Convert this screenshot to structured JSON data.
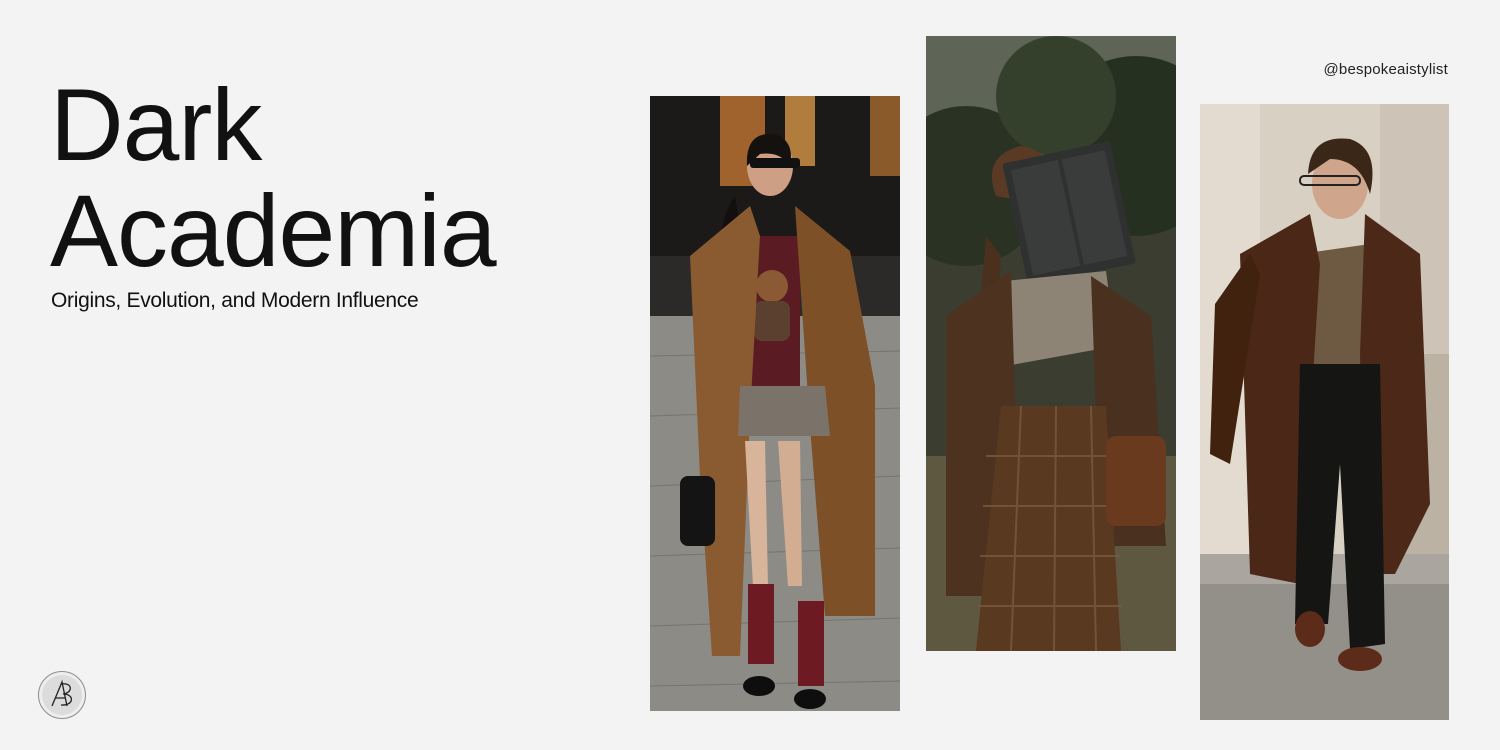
{
  "header": {
    "title_line1": "Dark",
    "title_line2": "Academia",
    "subtitle": "Origins, Evolution, and Modern Influence",
    "handle": "@bespokeaistylist"
  },
  "logo": {
    "icon": "ab-monogram-icon"
  },
  "photos": [
    {
      "icon": "photo-woman-long-camel-coat"
    },
    {
      "icon": "photo-woman-reading-book"
    },
    {
      "icon": "photo-man-brown-overcoat"
    }
  ],
  "colors": {
    "background": "#f3f3f3",
    "text": "#111111"
  }
}
